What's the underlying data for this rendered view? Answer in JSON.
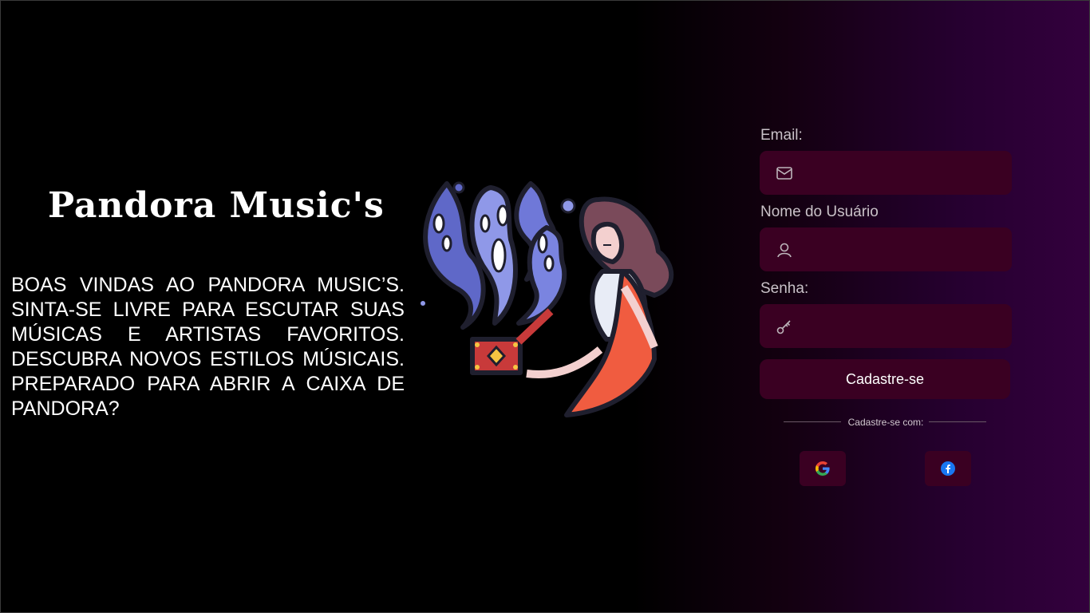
{
  "brand": {
    "title": "Pandora Music's",
    "welcome_text": "BOAS VINDAS AO PANDORA MUSIC’S. SINTA-SE LIVRE PARA ESCUTAR SUAS MÚSICAS E ARTISTAS FAVORITOS. DESCUBRA NOVOS ESTILOS MÚSICAIS. PREPARADO PARA ABRIR A CAIXA DE PANDORA?"
  },
  "illustration": {
    "icon": "pandora-box-woman-illustration"
  },
  "form": {
    "email": {
      "label": "Email:",
      "value": "",
      "icon": "envelope-icon"
    },
    "username": {
      "label": "Nome do Usuário",
      "value": "",
      "icon": "user-icon"
    },
    "password": {
      "label": "Senha:",
      "value": "",
      "icon": "key-icon"
    },
    "submit_label": "Cadastre-se",
    "social_caption": "Cadastre-se com:",
    "social": [
      {
        "icon": "google-icon"
      },
      {
        "icon": "facebook-icon"
      }
    ]
  },
  "colors": {
    "input_bg": "#3a0022",
    "gradient_end": "#33003d",
    "label_text": "#c9c2c8"
  }
}
